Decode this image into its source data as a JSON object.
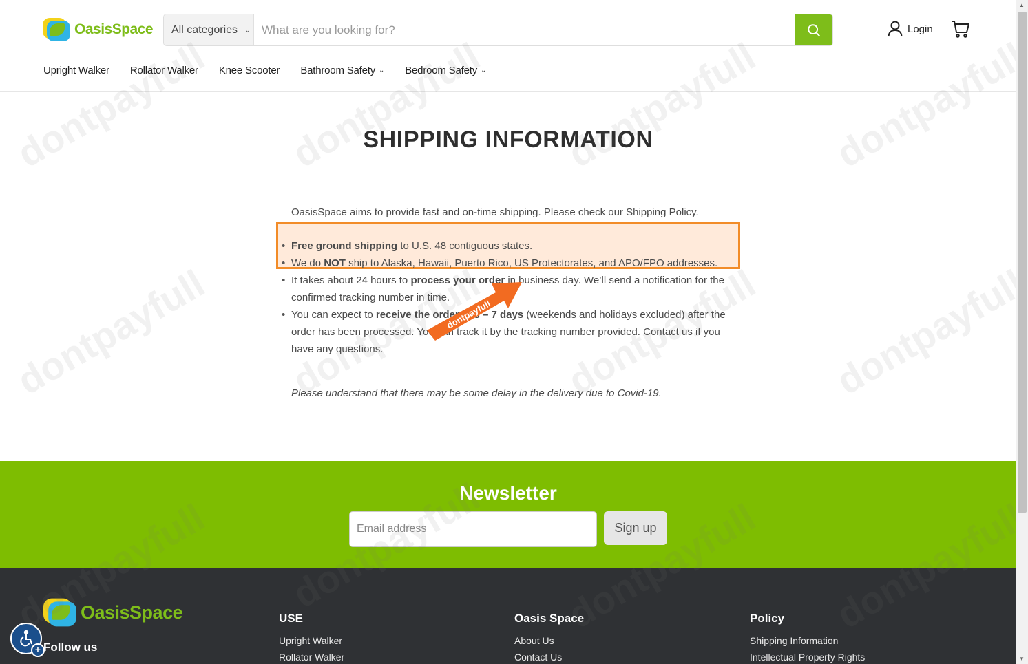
{
  "brand": {
    "name": "OasisSpace",
    "accent": "#7ebd1a"
  },
  "header": {
    "category_select": "All categories",
    "search_placeholder": "What are you looking for?",
    "login_label": "Login"
  },
  "nav": {
    "items": [
      {
        "label": "Upright Walker",
        "dropdown": false
      },
      {
        "label": "Rollator Walker",
        "dropdown": false
      },
      {
        "label": "Knee Scooter",
        "dropdown": false
      },
      {
        "label": "Bathroom Safety",
        "dropdown": true
      },
      {
        "label": "Bedroom Safety",
        "dropdown": true
      }
    ]
  },
  "page": {
    "title": "SHIPPING INFORMATION",
    "intro": "OasisSpace aims to provide fast and on-time shipping. Please check our Shipping Policy.",
    "bullets": [
      {
        "bold": "Free ground shipping",
        "text": " to U.S. 48 contiguous states."
      },
      {
        "pre": "We do ",
        "bold": "NOT",
        "text": " ship to Alaska, Hawaii, Puerto Rico, US Protectorates, and APO/FPO addresses."
      },
      {
        "pre": "It takes about 24 hours to ",
        "bold": "process your order",
        "text": " in business day. We’ll send a notification for the confirmed tracking number in time."
      },
      {
        "pre": "You can expect to ",
        "bold": "receive the order in 3 – 7 days",
        "text": " (weekends and holidays excluded) after the order has been processed. You can track it by the tracking number provided. Contact us if you have any questions."
      }
    ],
    "note": "Please understand that there may be some delay in the delivery due to Covid-19."
  },
  "arrow_label": "dontpayfull",
  "watermark": "dontpayfull",
  "newsletter": {
    "title": "Newsletter",
    "email_placeholder": "Email address",
    "signup_label": "Sign up"
  },
  "footer": {
    "follow_label": "Follow us",
    "columns": [
      {
        "title": "USE",
        "links": [
          "Upright Walker",
          "Rollator Walker"
        ]
      },
      {
        "title": "Oasis Space",
        "links": [
          "About Us",
          "Contact Us"
        ]
      },
      {
        "title": "Policy",
        "links": [
          "Shipping Information",
          "Intellectual Property Rights"
        ]
      }
    ]
  }
}
